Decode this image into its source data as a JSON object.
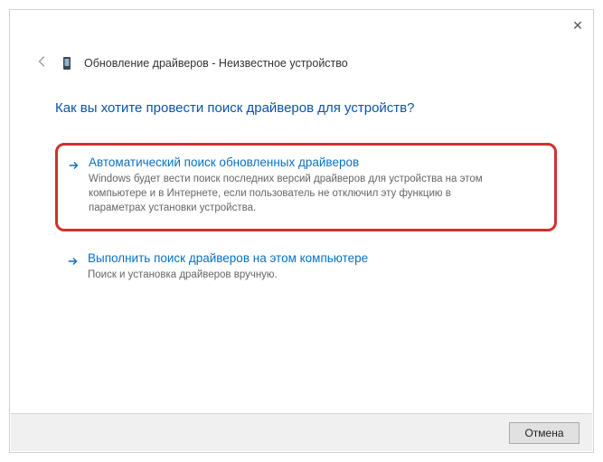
{
  "titlebar": {
    "close_glyph": "✕"
  },
  "header": {
    "title": "Обновление драйверов - Неизвестное устройство"
  },
  "main": {
    "heading": "Как вы хотите провести поиск драйверов для устройств?",
    "options": [
      {
        "highlighted": true,
        "title": "Автоматический поиск обновленных драйверов",
        "desc": "Windows будет вести поиск последних версий драйверов для устройства на этом компьютере и в Интернете, если пользователь не отключил эту функцию в параметрах установки устройства."
      },
      {
        "highlighted": false,
        "title": "Выполнить поиск драйверов на этом компьютере",
        "desc": "Поиск и установка драйверов вручную."
      }
    ]
  },
  "footer": {
    "cancel_label": "Отмена"
  },
  "colors": {
    "accent": "#0a6fc2",
    "highlight_border": "#d03030"
  }
}
